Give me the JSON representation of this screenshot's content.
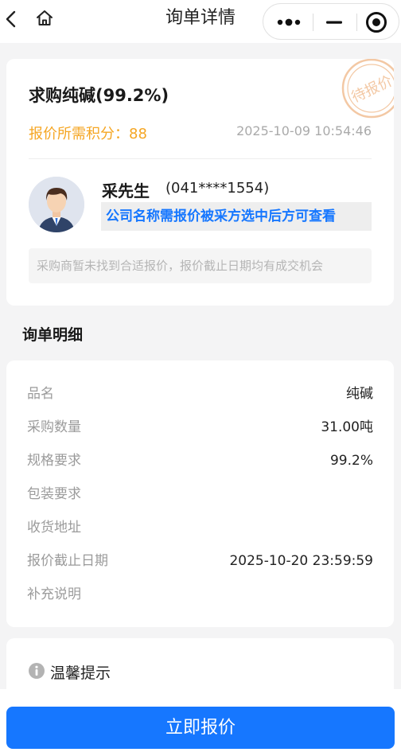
{
  "header": {
    "title": "询单详情",
    "back_icon": "chevron-left-icon",
    "home_icon": "home-icon",
    "more_icon": "more-dots-icon",
    "minimize_icon": "minimize-icon",
    "close_icon": "target-close-icon"
  },
  "inquiry": {
    "title": "求购纯碱(99.2%)",
    "points_text": "报价所需积分：88",
    "timestamp": "2025-10-09 10:54:46",
    "stamp_text": "待报价",
    "buyer_name": "采先生",
    "buyer_phone": "(041****1554)",
    "company_notice": "公司名称需报价被采方选中后方可查看",
    "hint": "采购商暂未找到合适报价，报价截止日期均有成交机会"
  },
  "details": {
    "section_title": "询单明细",
    "rows": [
      {
        "label": "品名",
        "value": "纯碱"
      },
      {
        "label": "采购数量",
        "value": "31.00吨"
      },
      {
        "label": "规格要求",
        "value": "99.2%"
      },
      {
        "label": "包装要求",
        "value": ""
      },
      {
        "label": "收货地址",
        "value": ""
      },
      {
        "label": "报价截止日期",
        "value": "2025-10-20 23:59:59"
      },
      {
        "label": "补充说明",
        "value": ""
      }
    ]
  },
  "tips": {
    "title": "温馨提示",
    "icon": "info-icon"
  },
  "footer": {
    "quote_button": "立即报价"
  },
  "colors": {
    "accent": "#1677ff",
    "points": "#f5a623",
    "stamp": "#f3c8a4"
  }
}
